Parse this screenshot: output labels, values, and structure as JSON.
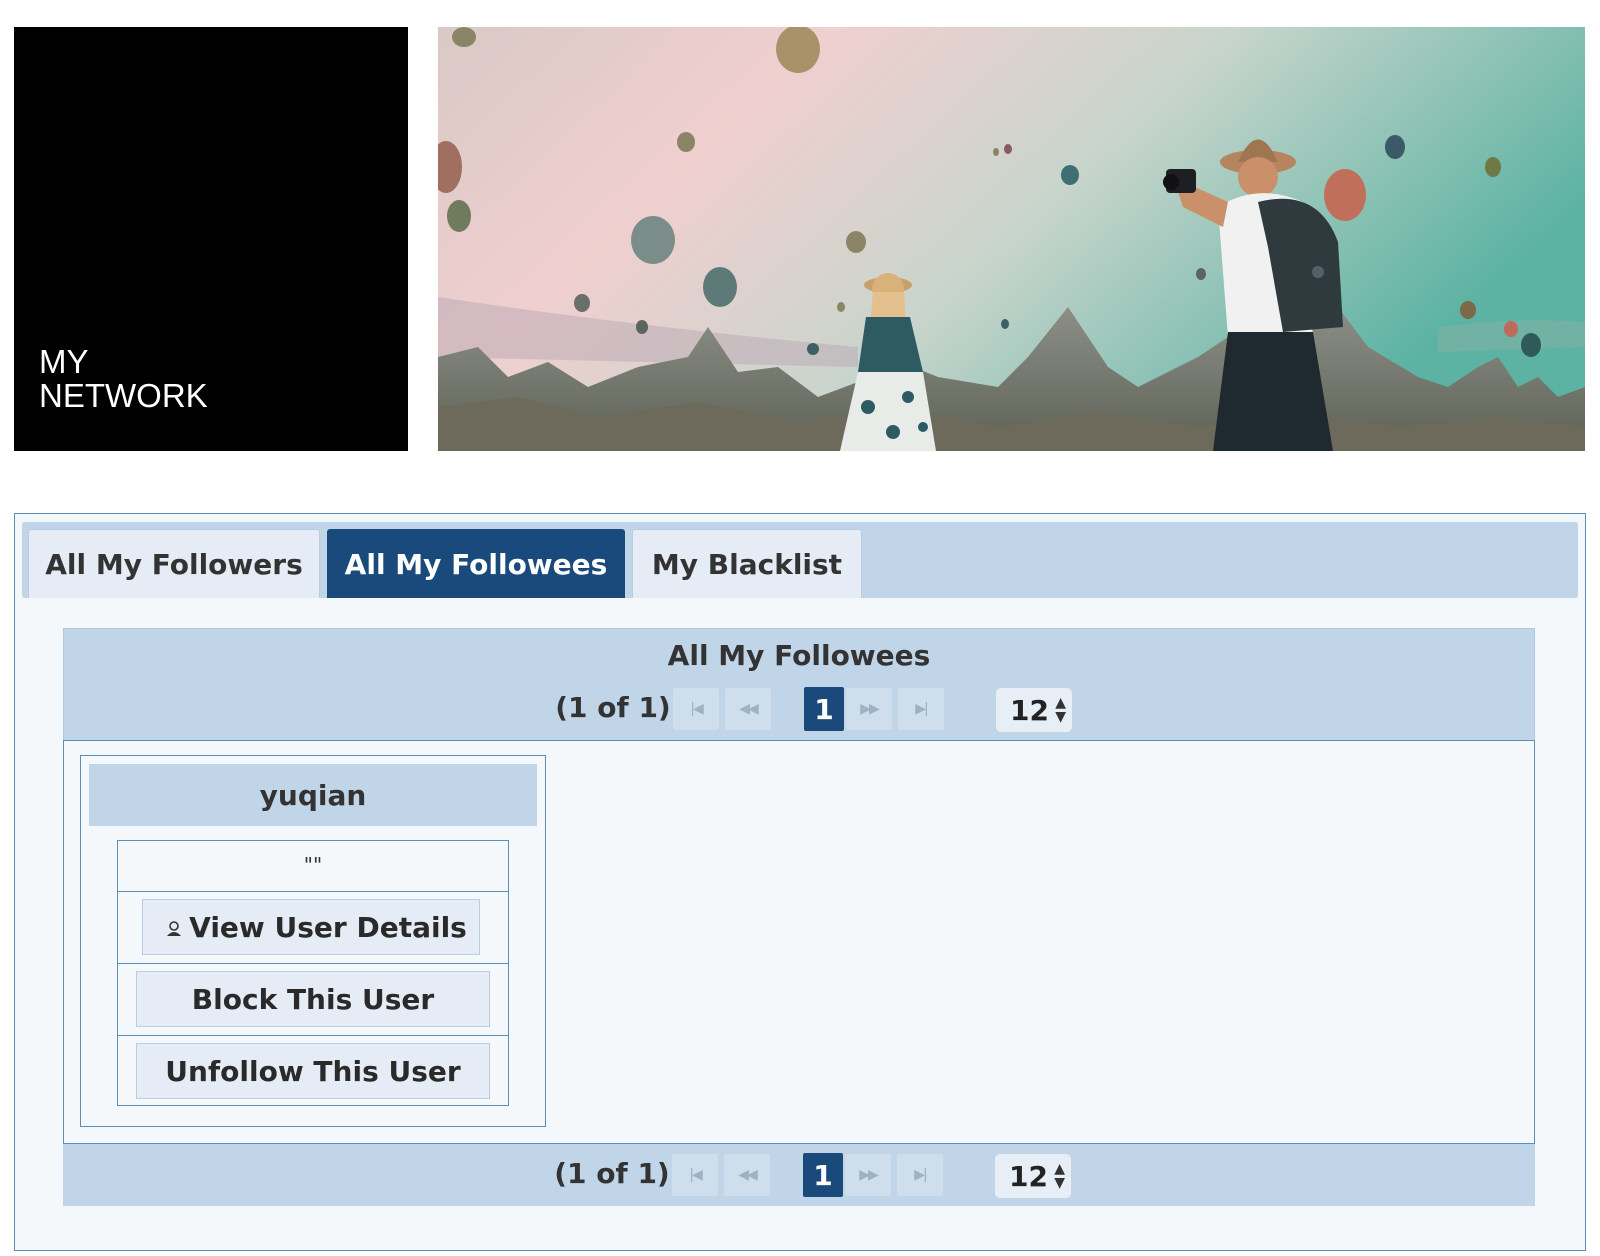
{
  "header": {
    "logo_text": "MY\nNETWORK"
  },
  "tabs": [
    {
      "label": "All My Followers",
      "active": false
    },
    {
      "label": "All My Followees",
      "active": true
    },
    {
      "label": "My Blacklist",
      "active": false
    }
  ],
  "grid": {
    "title": "All My Followees",
    "paginator": {
      "current_report": "(1 of 1)",
      "page": "1",
      "rows_per_page": "12",
      "first_icon": "first-page-icon",
      "prev_icon": "prev-page-icon",
      "next_icon": "next-page-icon",
      "last_icon": "last-page-icon"
    },
    "items": [
      {
        "username": "yuqian",
        "description": "\"\"",
        "view_label": "View User Details",
        "block_label": "Block This User",
        "unfollow_label": "Unfollow This User"
      }
    ]
  },
  "colors": {
    "accent": "#1a4a7c",
    "panel": "#c0d5e8",
    "border": "#5b8db5"
  }
}
